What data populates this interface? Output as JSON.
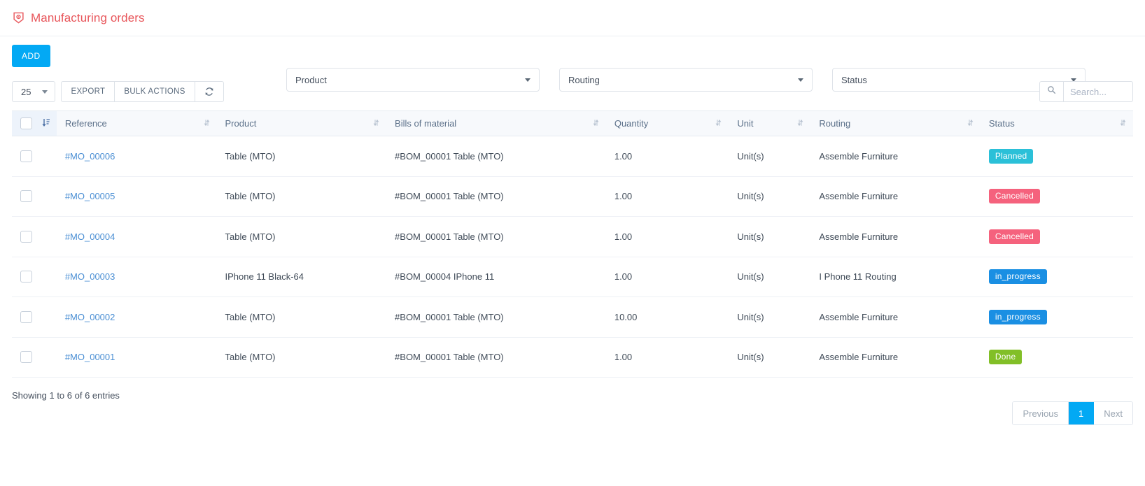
{
  "header": {
    "icon": "manufacturing-badge-icon",
    "title": "Manufacturing orders",
    "title_color": "#e8555a"
  },
  "toolbar": {
    "add_label": "ADD",
    "add_color": "#03a9f4",
    "entries_value": "25",
    "export_label": "EXPORT",
    "bulk_actions_label": "BULK ACTIONS",
    "refresh_icon": "refresh-icon",
    "search_icon": "search-icon",
    "search_value": "",
    "search_placeholder": "Search..."
  },
  "filters": [
    {
      "name": "product",
      "label": "Product"
    },
    {
      "name": "routing",
      "label": "Routing"
    },
    {
      "name": "status",
      "label": "Status"
    }
  ],
  "table": {
    "columns": [
      {
        "key": "checkbox",
        "label": "",
        "sort": "sort-desc-active"
      },
      {
        "key": "reference",
        "label": "Reference",
        "sort": "sort-both"
      },
      {
        "key": "product",
        "label": "Product",
        "sort": "sort-both"
      },
      {
        "key": "bills_of_material",
        "label": "Bills of material",
        "sort": "sort-both"
      },
      {
        "key": "quantity",
        "label": "Quantity",
        "sort": "sort-both"
      },
      {
        "key": "unit",
        "label": "Unit",
        "sort": "sort-both"
      },
      {
        "key": "routing",
        "label": "Routing",
        "sort": "sort-both"
      },
      {
        "key": "status",
        "label": "Status",
        "sort": "sort-both"
      }
    ],
    "rows": [
      {
        "reference": "#MO_00006",
        "product": "Table (MTO)",
        "bills_of_material": "#BOM_00001 Table (MTO)",
        "quantity": "1.00",
        "unit": "Unit(s)",
        "routing": "Assemble Furniture",
        "status": "Planned",
        "status_color": "#2bc0d8"
      },
      {
        "reference": "#MO_00005",
        "product": "Table (MTO)",
        "bills_of_material": "#BOM_00001 Table (MTO)",
        "quantity": "1.00",
        "unit": "Unit(s)",
        "routing": "Assemble Furniture",
        "status": "Cancelled",
        "status_color": "#f5627d"
      },
      {
        "reference": "#MO_00004",
        "product": "Table (MTO)",
        "bills_of_material": "#BOM_00001 Table (MTO)",
        "quantity": "1.00",
        "unit": "Unit(s)",
        "routing": "Assemble Furniture",
        "status": "Cancelled",
        "status_color": "#f5627d"
      },
      {
        "reference": "#MO_00003",
        "product": "IPhone 11 Black-64",
        "bills_of_material": "#BOM_00004 IPhone 11",
        "quantity": "1.00",
        "unit": "Unit(s)",
        "routing": "I Phone 11 Routing",
        "status": "in_progress",
        "status_color": "#1a8fe3"
      },
      {
        "reference": "#MO_00002",
        "product": "Table (MTO)",
        "bills_of_material": "#BOM_00001 Table (MTO)",
        "quantity": "10.00",
        "unit": "Unit(s)",
        "routing": "Assemble Furniture",
        "status": "in_progress",
        "status_color": "#1a8fe3"
      },
      {
        "reference": "#MO_00001",
        "product": "Table (MTO)",
        "bills_of_material": "#BOM_00001 Table (MTO)",
        "quantity": "1.00",
        "unit": "Unit(s)",
        "routing": "Assemble Furniture",
        "status": "Done",
        "status_color": "#82bf27"
      }
    ]
  },
  "footer": {
    "entries_info": "Showing 1 to 6 of 6 entries",
    "previous_label": "Previous",
    "page_1_label": "1",
    "next_label": "Next"
  }
}
